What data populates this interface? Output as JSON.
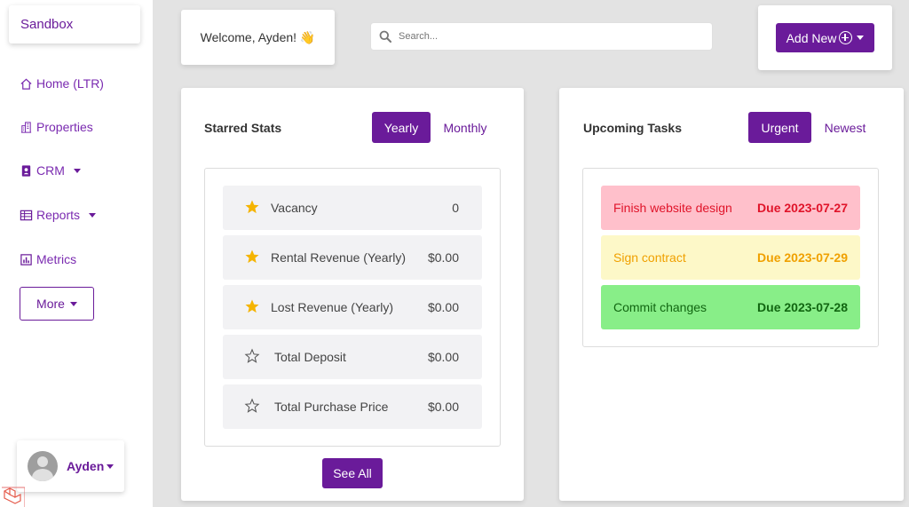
{
  "sidebar": {
    "brand": "Sandbox",
    "items": [
      {
        "label": "Home (LTR)",
        "icon": "home-icon"
      },
      {
        "label": "Properties",
        "icon": "building-icon"
      },
      {
        "label": "CRM",
        "icon": "contact-icon"
      },
      {
        "label": "Reports",
        "icon": "table-icon"
      },
      {
        "label": "Metrics",
        "icon": "bar-chart-icon"
      }
    ],
    "more_label": "More",
    "user_name": "Ayden"
  },
  "header": {
    "welcome": "Welcome, Ayden! 👋",
    "search_placeholder": "Search...",
    "add_new_label": "Add New"
  },
  "starred_stats": {
    "title": "Starred Stats",
    "tabs": [
      "Yearly",
      "Monthly"
    ],
    "active_tab": "Yearly",
    "rows": [
      {
        "label": "Vacancy",
        "value": "0",
        "starred": true
      },
      {
        "label": "Rental Revenue (Yearly)",
        "value": "$0.00",
        "starred": true
      },
      {
        "label": "Lost Revenue (Yearly)",
        "value": "$0.00",
        "starred": true
      },
      {
        "label": "Total Deposit",
        "value": "$0.00",
        "starred": false
      },
      {
        "label": "Total Purchase Price",
        "value": "$0.00",
        "starred": false
      }
    ],
    "see_all_label": "See All"
  },
  "upcoming_tasks": {
    "title": "Upcoming Tasks",
    "tabs": [
      "Urgent",
      "Newest"
    ],
    "active_tab": "Urgent",
    "tasks": [
      {
        "name": "Finish website design",
        "due": "Due 2023-07-27",
        "bg": "#ffc0cb",
        "color": "#e0142a"
      },
      {
        "name": "Sign contract",
        "due": "Due 2023-07-29",
        "bg": "#fdf8c8",
        "color": "#f0a000"
      },
      {
        "name": "Commit changes",
        "due": "Due 2023-07-28",
        "bg": "#88ee88",
        "color": "#116611"
      }
    ]
  },
  "colors": {
    "accent": "#6a1b9a",
    "star": "#f5b400"
  }
}
